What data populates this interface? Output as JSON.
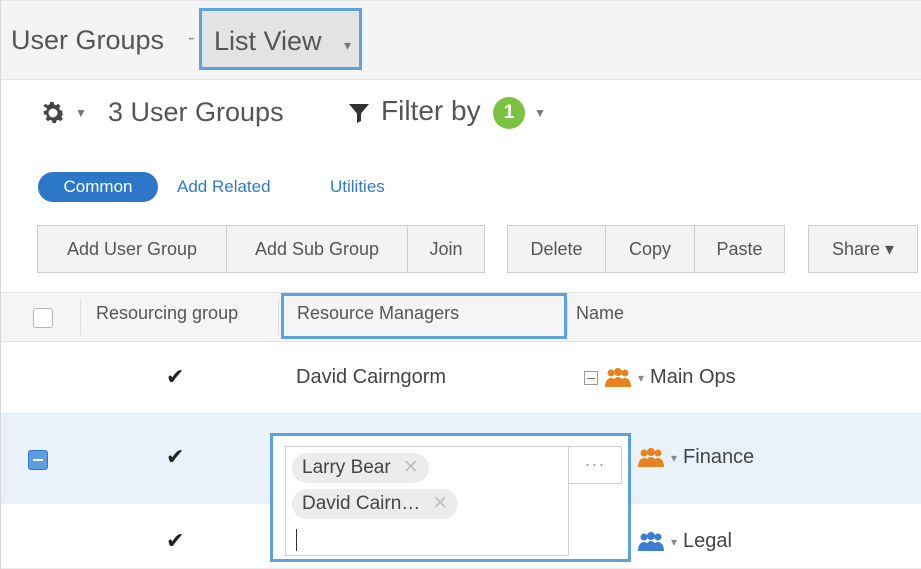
{
  "header": {
    "title": "User Groups",
    "separator": "-",
    "view_label": "List View",
    "view_caret": "▾"
  },
  "toolbar": {
    "gear_icon": "gear-icon",
    "count_label": "3 User Groups",
    "filter_label": "Filter by",
    "filter_count": "1"
  },
  "tabs": {
    "active": "Common",
    "links": [
      "Add Related",
      "Utilities"
    ]
  },
  "actions": {
    "add_user_group": "Add User Group",
    "add_sub_group": "Add Sub Group",
    "join": "Join",
    "delete": "Delete",
    "copy": "Copy",
    "paste": "Paste",
    "share": "Share ▾"
  },
  "grid": {
    "columns": [
      "Resourcing group",
      "Resource Managers",
      "Name"
    ],
    "rows": [
      {
        "resourcing": "✔",
        "managers": "David Cairngorm",
        "name": "Main Ops"
      },
      {
        "resourcing": "✔",
        "managers": "",
        "name": "Finance"
      },
      {
        "resourcing": "✔",
        "managers": "",
        "name": "Legal"
      }
    ]
  },
  "editor": {
    "chips": [
      "Larry Bear",
      "David Cairn…"
    ],
    "more_label": "···"
  },
  "colors": {
    "accent": "#2d77c9",
    "highlight": "#5ba2df",
    "badge": "#7cc242",
    "group_orange": "#e8821e",
    "group_blue": "#3b7ed1"
  }
}
